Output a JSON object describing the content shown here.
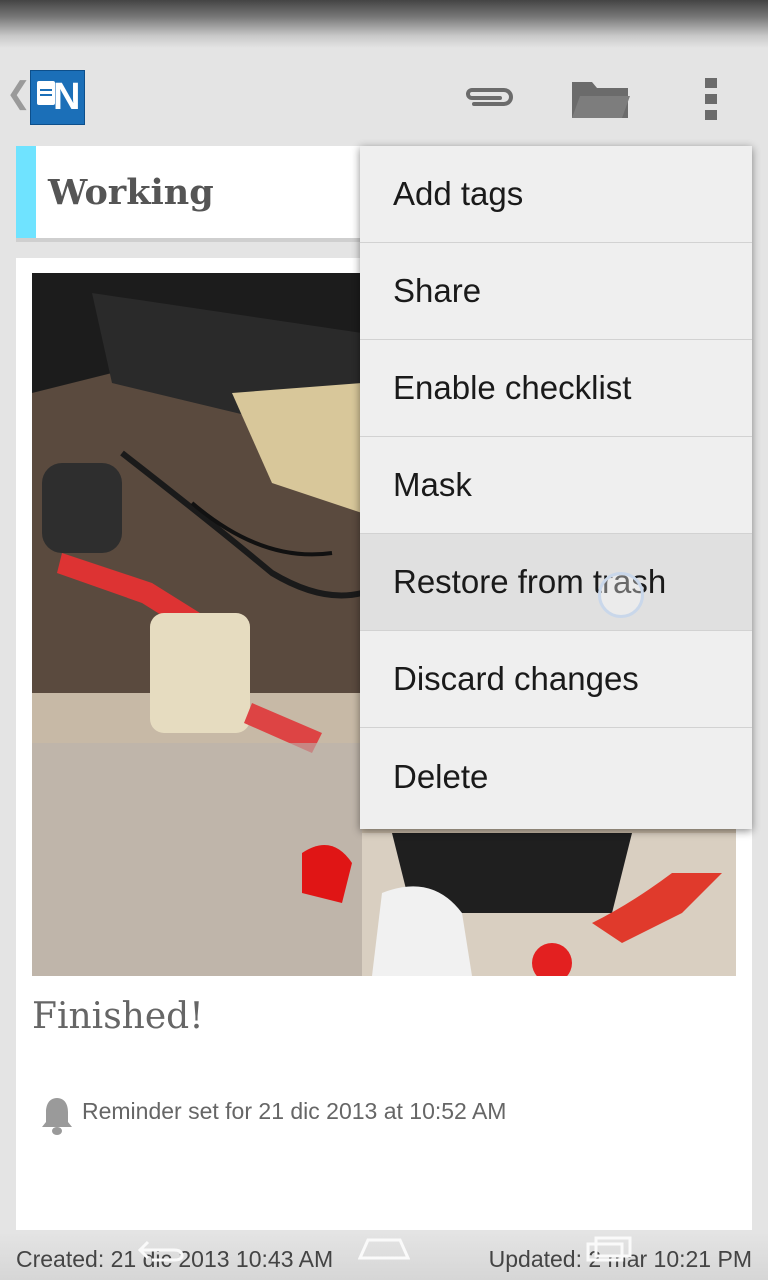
{
  "note": {
    "title": "Working",
    "body": "Finished!",
    "reminder": "Reminder set for 21 dic 2013 at 10:52 AM",
    "created": "Created: 21 dic 2013 10:43 AM",
    "updated": "Updated: 2 mar 10:21 PM"
  },
  "colors": {
    "category_accent": "#6fe3ff",
    "app_logo": "#1b6fb8"
  },
  "action_bar": {
    "icons": [
      "app-logo",
      "paperclip-icon",
      "folder-icon",
      "overflow-menu-icon"
    ]
  },
  "overflow_menu": {
    "items": [
      {
        "label": "Add tags"
      },
      {
        "label": "Share"
      },
      {
        "label": "Enable checklist"
      },
      {
        "label": "Mask"
      },
      {
        "label": "Restore from trash"
      },
      {
        "label": "Discard changes"
      },
      {
        "label": "Delete"
      }
    ],
    "pressed_item": "Restore from trash"
  }
}
